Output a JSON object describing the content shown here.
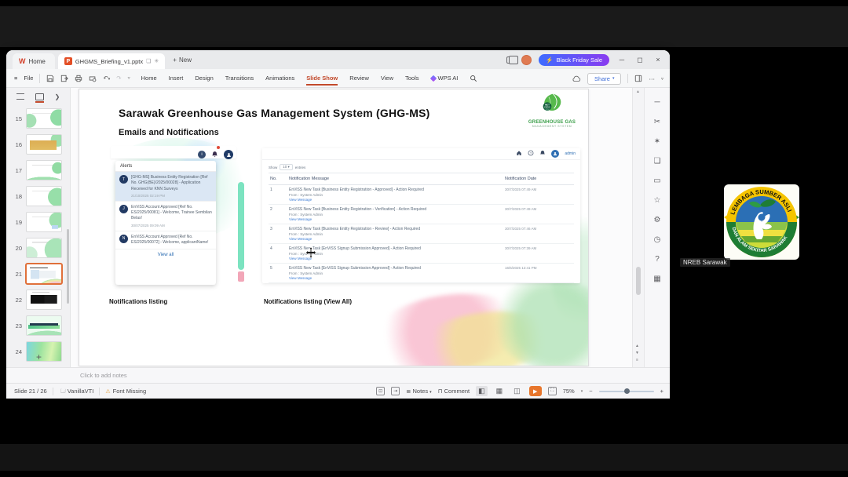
{
  "window": {
    "home_tab": "Home",
    "doc_tab": "GHGMS_Briefing_v1.pptx",
    "new_label": "New",
    "promo_label": "Black Friday Sale",
    "promo_icon": "⚡",
    "file_label": "File",
    "menus": [
      {
        "label": "Home",
        "cls": ""
      },
      {
        "label": "Insert",
        "cls": ""
      },
      {
        "label": "Design",
        "cls": ""
      },
      {
        "label": "Transitions",
        "cls": ""
      },
      {
        "label": "Animations",
        "cls": ""
      },
      {
        "label": "Slide Show",
        "cls": "active"
      },
      {
        "label": "Review",
        "cls": ""
      },
      {
        "label": "View",
        "cls": ""
      },
      {
        "label": "Tools",
        "cls": ""
      }
    ],
    "wps_ai": "WPS AI",
    "share_label": "Share",
    "minimize": "─",
    "maximize": "◻",
    "close": "×"
  },
  "thumbnails": {
    "items": [
      {
        "num": "15",
        "cls": "v15"
      },
      {
        "num": "16",
        "cls": "v16"
      },
      {
        "num": "17",
        "cls": "v17"
      },
      {
        "num": "18",
        "cls": "v18"
      },
      {
        "num": "19",
        "cls": "v19"
      },
      {
        "num": "20",
        "cls": "v20"
      },
      {
        "num": "21",
        "cls": "v21 sel"
      },
      {
        "num": "22",
        "cls": "v22"
      },
      {
        "num": "23",
        "cls": "v23"
      },
      {
        "num": "24",
        "cls": "v24"
      }
    ],
    "add_label": "+"
  },
  "slide": {
    "title": "Sarawak Greenhouse Gas Management System (GHG-MS)",
    "subtitle": "Emails and Notifications",
    "logo_line1": "GREENHOUSE GAS",
    "logo_line2": "MANAGEMENT SYSTEM",
    "caption_left": "Notifications listing",
    "caption_right": "Notifications listing (View All)",
    "alerts_panel": {
      "header": "Alerts",
      "items": [
        {
          "initial": "T",
          "text": "[GHG-MS] Business Entity Registration [Ref No. GHG(BE)/2025/00028] - Application Received for KNN Surveys",
          "date": "21/10/2025 02:19 PM",
          "cls": "highlight"
        },
        {
          "initial": "J",
          "text": "EnViSS Account Approved [Ref No. ES/2025/00081] - Welcome, Trainee Sembilan Belas!",
          "date": "30/07/2025 09:09 AM",
          "cls": ""
        },
        {
          "initial": "N",
          "text": "EnViSS Account Approved [Ref No. ES/2025/00072] - Welcome, applicantName!",
          "date": "",
          "cls": ""
        }
      ],
      "view_all": "View all"
    },
    "table_panel": {
      "admin_label": "admin",
      "show_label": "Show",
      "show_value": "10",
      "entries_label": "entries",
      "columns": [
        "No.",
        "Notification Message",
        "Notification Date"
      ],
      "rows": [
        {
          "no": "1",
          "message": "EnViSS New Task [Business Entity Registration - Approved] - Action Required",
          "from": "From : System Admin",
          "link": "View Message",
          "date": "30/7/2025 07:49 AM"
        },
        {
          "no": "2",
          "message": "EnViSS New Task [Business Entity Registration - Verification] - Action Required",
          "from": "From : System Admin",
          "link": "View Message",
          "date": "30/7/2025 07:49 AM"
        },
        {
          "no": "3",
          "message": "EnViSS New Task [Business Entity Registration - Review] - Action Required",
          "from": "From : System Admin",
          "link": "View Message",
          "date": "30/7/2025 07:46 AM"
        },
        {
          "no": "4",
          "message": "EnViSS New Task [EnViSS Signup Submission Approved] - Action Required",
          "from": "From : System Admin",
          "link": "View Message",
          "date": "30/7/2025 07:39 AM"
        },
        {
          "no": "5",
          "message": "EnViSS New Task [EnViSS Signup Submission Approved] - Action Required",
          "from": "From : System Admin",
          "link": "View Message",
          "date": "16/6/2025 12:41 PM"
        }
      ]
    }
  },
  "notes_placeholder": "Click to add notes",
  "statusbar": {
    "slide_indicator": "Slide 21 / 26",
    "theme_name": "VanillaVTI",
    "warn_icon": "⚠",
    "font_missing": "Font Missing",
    "notes_label": "Notes",
    "comment_label": "Comment",
    "play_icon": "▶",
    "zoom_level": "75%",
    "zoom_out": "−",
    "zoom_in": "+"
  },
  "rightbar": {
    "icons": [
      {
        "name": "collapse-pane-icon",
        "glyph": "─"
      },
      {
        "name": "design-tools-icon",
        "glyph": "✂"
      },
      {
        "name": "animation-icon",
        "glyph": "✶"
      },
      {
        "name": "objects-icon",
        "glyph": "❏"
      },
      {
        "name": "comment-pane-icon",
        "glyph": "▭"
      },
      {
        "name": "favorites-icon",
        "glyph": "☆"
      },
      {
        "name": "settings-icon",
        "glyph": "⚙"
      },
      {
        "name": "history-icon",
        "glyph": "◷"
      },
      {
        "name": "help-icon",
        "glyph": "?"
      },
      {
        "name": "apps-grid-icon",
        "glyph": "▦"
      }
    ]
  },
  "meeting": {
    "participant_label": "NREB Sarawak",
    "logo_arc_top": "LEMBAGA SUMBER ASLI",
    "logo_arc_bottom": "DAN ALAM SEKITAR SARAWAK"
  }
}
